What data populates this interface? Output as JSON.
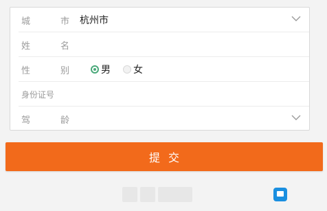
{
  "form": {
    "city": {
      "label": "城　市",
      "label_chars": [
        "城",
        "市"
      ],
      "value": "杭州市"
    },
    "name": {
      "label_chars": [
        "姓",
        "名"
      ],
      "value": ""
    },
    "gender": {
      "label_chars": [
        "性",
        "别"
      ],
      "options": [
        {
          "label": "男",
          "checked": true
        },
        {
          "label": "女",
          "checked": false
        }
      ]
    },
    "id_number": {
      "label": "身份证号",
      "value": ""
    },
    "driving_age": {
      "label_chars": [
        "驾",
        "龄"
      ],
      "value": ""
    }
  },
  "submit": {
    "label": "提交"
  },
  "colors": {
    "accent": "#f26a1b",
    "radio_checked": "#4aa97a",
    "watermark": "#1a8fe0"
  },
  "icons": {
    "dropdown": "chevron-down-icon",
    "watermark": "site-logo-icon"
  }
}
